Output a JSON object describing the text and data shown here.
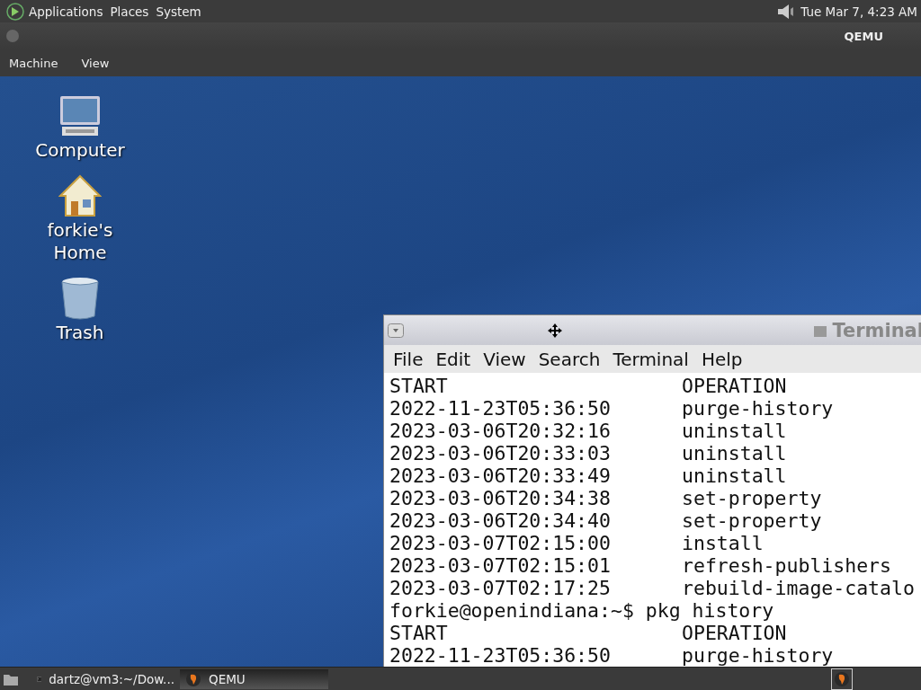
{
  "top_panel": {
    "menus": [
      "Applications",
      "Places",
      "System"
    ],
    "clock": "Tue Mar  7,  4:23 AM"
  },
  "qemu_window": {
    "title": "QEMU",
    "menus": [
      "Machine",
      "View"
    ]
  },
  "desktop_icons": [
    {
      "kind": "computer",
      "label": "Computer"
    },
    {
      "kind": "home",
      "label": "forkie's Home"
    },
    {
      "kind": "trash",
      "label": "Trash"
    }
  ],
  "terminal": {
    "title": "Terminal",
    "menus": [
      "File",
      "Edit",
      "View",
      "Search",
      "Terminal",
      "Help"
    ],
    "lines": [
      {
        "kind": "row",
        "start": "START",
        "operation": "OPERATION"
      },
      {
        "kind": "row",
        "start": "2022-11-23T05:36:50",
        "operation": "purge-history"
      },
      {
        "kind": "row",
        "start": "2023-03-06T20:32:16",
        "operation": "uninstall"
      },
      {
        "kind": "row",
        "start": "2023-03-06T20:33:03",
        "operation": "uninstall"
      },
      {
        "kind": "row",
        "start": "2023-03-06T20:33:49",
        "operation": "uninstall"
      },
      {
        "kind": "row",
        "start": "2023-03-06T20:34:38",
        "operation": "set-property"
      },
      {
        "kind": "row",
        "start": "2023-03-06T20:34:40",
        "operation": "set-property"
      },
      {
        "kind": "row",
        "start": "2023-03-07T02:15:00",
        "operation": "install"
      },
      {
        "kind": "row",
        "start": "2023-03-07T02:15:01",
        "operation": "refresh-publishers"
      },
      {
        "kind": "row",
        "start": "2023-03-07T02:17:25",
        "operation": "rebuild-image-catalo"
      },
      {
        "kind": "prompt",
        "text": "forkie@openindiana:~$ pkg history"
      },
      {
        "kind": "row",
        "start": "START",
        "operation": "OPERATION"
      },
      {
        "kind": "row",
        "start": "2022-11-23T05:36:50",
        "operation": "purge-history"
      }
    ]
  },
  "taskbar": {
    "tasks": [
      {
        "kind": "terminal",
        "label": "dartz@vm3:~/Dow...",
        "selected": false
      },
      {
        "kind": "qemu",
        "label": "QEMU",
        "selected": true
      }
    ]
  }
}
